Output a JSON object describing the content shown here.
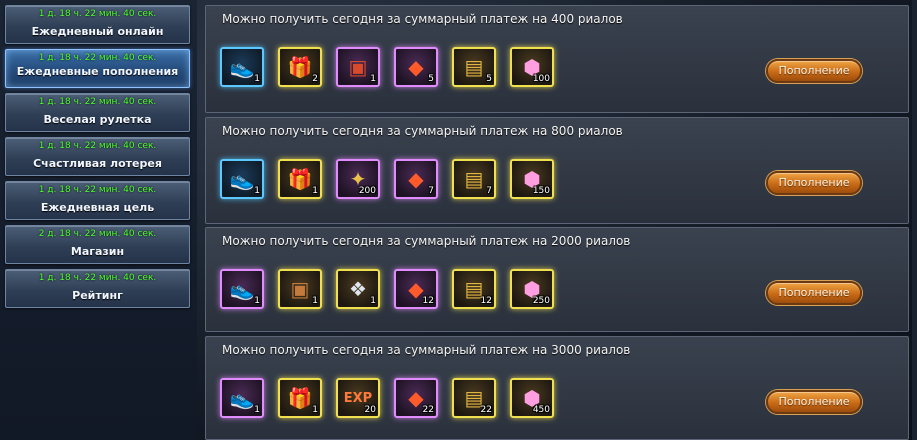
{
  "sidebar": {
    "items": [
      {
        "timer": "1 д. 18 ч. 22 мин. 40 сек.",
        "label": "Ежедневный онлайн"
      },
      {
        "timer": "1 д. 18 ч. 22 мин. 40 сек.",
        "label": "Ежедневные пополнения",
        "active": true
      },
      {
        "timer": "1 д. 18 ч. 22 мин. 40 сек.",
        "label": "Веселая рулетка"
      },
      {
        "timer": "1 д. 18 ч. 22 мин. 40 сек.",
        "label": "Счастливая лотерея"
      },
      {
        "timer": "1 д. 18 ч. 22 мин. 40 сек.",
        "label": "Ежедневная цель"
      },
      {
        "timer": "2 д. 18 ч. 22 мин. 40 сек.",
        "label": "Магазин"
      },
      {
        "timer": "1 д. 18 ч. 22 мин. 40 сек.",
        "label": "Рейтинг"
      }
    ]
  },
  "panels": [
    {
      "title": "Можно получить сегодня за суммарный платеж на 400 риалов",
      "button": "Пополнение",
      "items": [
        {
          "icon": "gold-shoe-icon",
          "count": "1",
          "frame": "blue"
        },
        {
          "icon": "blue-striped-gift-icon",
          "count": "2",
          "frame": "yellow"
        },
        {
          "icon": "red-chest-icon",
          "count": "1",
          "frame": "pink"
        },
        {
          "icon": "red-card-icon",
          "count": "5",
          "frame": "pink"
        },
        {
          "icon": "gold-ticket-icon",
          "count": "5",
          "frame": "yellow"
        },
        {
          "icon": "pink-gem-icon",
          "count": "100",
          "frame": "yellow"
        }
      ]
    },
    {
      "title": "Можно получить сегодня за суммарный платеж на 800 риалов",
      "button": "Пополнение",
      "items": [
        {
          "icon": "gold-shoe-icon",
          "count": "1",
          "frame": "blue"
        },
        {
          "icon": "green-striped-gift-icon",
          "count": "1",
          "frame": "yellow"
        },
        {
          "icon": "gold-scroll-icon",
          "count": "200",
          "frame": "pink"
        },
        {
          "icon": "red-card-icon",
          "count": "7",
          "frame": "pink"
        },
        {
          "icon": "gold-ticket-icon",
          "count": "7",
          "frame": "yellow"
        },
        {
          "icon": "pink-gem-icon",
          "count": "150",
          "frame": "yellow"
        }
      ]
    },
    {
      "title": "Можно получить сегодня за суммарный платеж на 2000 риалов",
      "button": "Пополнение",
      "items": [
        {
          "icon": "gold-shoe-icon",
          "count": "1",
          "frame": "pink"
        },
        {
          "icon": "ornate-chest-icon",
          "count": "1",
          "frame": "yellow"
        },
        {
          "icon": "wolf-pet-icon",
          "count": "1",
          "frame": "yellow"
        },
        {
          "icon": "red-card-icon",
          "count": "12",
          "frame": "pink"
        },
        {
          "icon": "gold-ticket-icon",
          "count": "12",
          "frame": "yellow"
        },
        {
          "icon": "pink-gem-icon",
          "count": "250",
          "frame": "yellow"
        }
      ]
    },
    {
      "title": "Можно получить сегодня за суммарный платеж на 3000 риалов",
      "button": "Пополнение",
      "items": [
        {
          "icon": "gold-shoe-icon",
          "count": "1",
          "frame": "pink"
        },
        {
          "icon": "pink-gift-box-icon",
          "count": "1",
          "frame": "yellow"
        },
        {
          "icon": "exp-orb-icon",
          "count": "20",
          "frame": "yellow"
        },
        {
          "icon": "red-card-icon",
          "count": "22",
          "frame": "pink"
        },
        {
          "icon": "gold-ticket-icon",
          "count": "22",
          "frame": "yellow"
        },
        {
          "icon": "pink-gem-icon",
          "count": "450",
          "frame": "yellow"
        }
      ]
    }
  ]
}
